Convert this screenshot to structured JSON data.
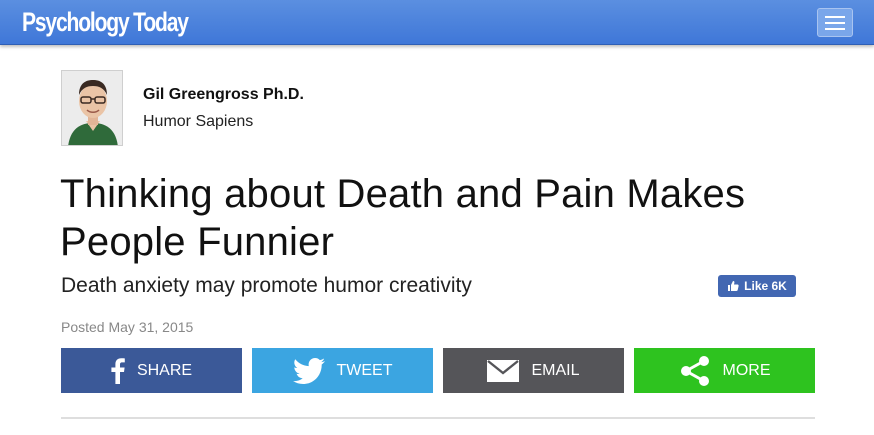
{
  "header": {
    "logo_text": "Psychology Today",
    "menu_icon": "hamburger-menu-icon",
    "background_color": "#4a82dc"
  },
  "author": {
    "name": "Gil Greengross Ph.D.",
    "blog": "Humor Sapiens"
  },
  "article": {
    "title": "Thinking about Death and Pain Makes People Funnier",
    "subtitle": "Death anxiety may promote humor creativity",
    "posted": "Posted May 31, 2015"
  },
  "like": {
    "label": "Like 6K",
    "icon": "thumbs-up-icon",
    "color": "#4267b2"
  },
  "share": {
    "facebook": {
      "label": "SHARE",
      "icon": "facebook-icon",
      "color": "#3b5998"
    },
    "twitter": {
      "label": "TWEET",
      "icon": "twitter-bird-icon",
      "color": "#3ba5e1"
    },
    "email": {
      "label": "EMAIL",
      "icon": "envelope-icon",
      "color": "#555559"
    },
    "more": {
      "label": "MORE",
      "icon": "share-nodes-icon",
      "color": "#2ec31f"
    }
  }
}
